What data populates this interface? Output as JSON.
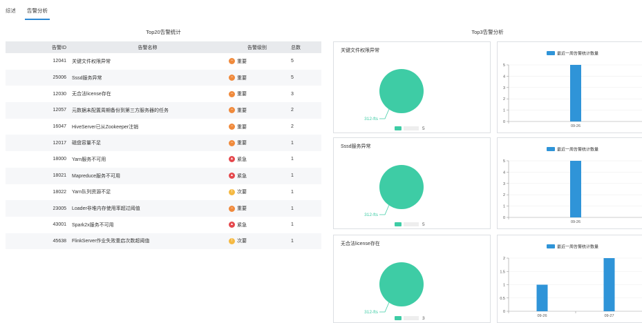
{
  "tabs": [
    {
      "label": "综述",
      "active": false
    },
    {
      "label": "告警分析",
      "active": true
    }
  ],
  "left_title": "Top20告警统计",
  "right_title": "Top3告警分析",
  "table": {
    "headers": [
      "告警ID",
      "告警名称",
      "告警级别",
      "总数"
    ],
    "rows": [
      {
        "id": "12041",
        "name": "关键文件权限异常",
        "level": "重要",
        "level_type": "major",
        "count": "5"
      },
      {
        "id": "25006",
        "name": "Sssd服务异常",
        "level": "重要",
        "level_type": "major",
        "count": "5"
      },
      {
        "id": "12030",
        "name": "无合法license存在",
        "level": "重要",
        "level_type": "major",
        "count": "3"
      },
      {
        "id": "12057",
        "name": "元数据未配置周期备份到第三方服务器的任务",
        "level": "重要",
        "level_type": "major",
        "count": "2"
      },
      {
        "id": "16047",
        "name": "HiveServer已从Zookeeper注销",
        "level": "重要",
        "level_type": "major",
        "count": "2"
      },
      {
        "id": "12017",
        "name": "磁盘容量不足",
        "level": "重要",
        "level_type": "major",
        "count": "1"
      },
      {
        "id": "18000",
        "name": "Yarn服务不可用",
        "level": "紧急",
        "level_type": "critical",
        "count": "1"
      },
      {
        "id": "18021",
        "name": "Mapreduce服务不可用",
        "level": "紧急",
        "level_type": "critical",
        "count": "1"
      },
      {
        "id": "18022",
        "name": "Yarn队列资源不足",
        "level": "次要",
        "level_type": "minor",
        "count": "1"
      },
      {
        "id": "23005",
        "name": "Loader非堆内存使用率超过阈值",
        "level": "重要",
        "level_type": "major",
        "count": "1"
      },
      {
        "id": "43001",
        "name": "Spark2x服务不可用",
        "level": "紧急",
        "level_type": "critical",
        "count": "1"
      },
      {
        "id": "45638",
        "name": "FlinkServer作业失败重启次数超阈值",
        "level": "次要",
        "level_type": "minor",
        "count": "1"
      }
    ]
  },
  "level_colors": {
    "major": "#f08a3c",
    "critical": "#e5484d",
    "minor": "#f5b942"
  },
  "level_icons": {
    "major": "minus-circle-icon",
    "critical": "flame-icon",
    "minor": "warning-circle-icon"
  },
  "pie_color": "#3ecca5",
  "bar_color": "#2f94d8",
  "top3": [
    {
      "title": "关键文件权限异常",
      "pie_label": "312-fts",
      "pie_legend_value": "5",
      "bar_legend": "最近一周告警统计数量",
      "chart_data": {
        "type": "bar",
        "categories": [
          "09-26"
        ],
        "values": [
          5
        ],
        "ylim": [
          0,
          5
        ],
        "yticks": [
          0,
          1,
          2,
          3,
          4,
          5
        ]
      }
    },
    {
      "title": "Sssd服务异常",
      "pie_label": "312-fts",
      "pie_legend_value": "5",
      "bar_legend": "最近一周告警统计数量",
      "chart_data": {
        "type": "bar",
        "categories": [
          "09-26"
        ],
        "values": [
          5
        ],
        "ylim": [
          0,
          5
        ],
        "yticks": [
          0,
          1,
          2,
          3,
          4,
          5
        ]
      }
    },
    {
      "title": "无合法license存在",
      "pie_label": "312-fts",
      "pie_legend_value": "3",
      "bar_legend": "最近一周告警统计数量",
      "chart_data": {
        "type": "bar",
        "categories": [
          "09-26",
          "09-27"
        ],
        "values": [
          1,
          2
        ],
        "ylim": [
          0,
          2
        ],
        "yticks": [
          0,
          0.5,
          1,
          1.5,
          2
        ]
      }
    }
  ]
}
